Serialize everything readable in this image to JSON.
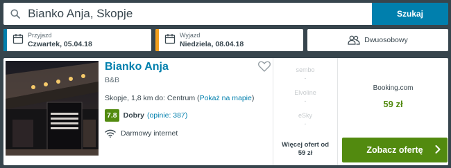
{
  "search": {
    "value": "Bianko Anja, Skopje",
    "button_label": "Szukaj"
  },
  "filters": {
    "checkin": {
      "label": "Przyjazd",
      "value": "Czwartek, 05.04.18",
      "color": "#007fad"
    },
    "checkout": {
      "label": "Wyjazd",
      "value": "Niedziela, 08.04.18",
      "color": "#f29f1d"
    },
    "room": {
      "label": "Dwuosobowy",
      "icon": "two-people-icon"
    }
  },
  "hotel": {
    "name": "Bianko Anja",
    "type": "B&B",
    "location_text": "Skopje, 1,8 km do: Centrum (",
    "map_link": "Pokaż na mapie",
    "location_close": ")",
    "rating_score": "7.8",
    "rating_label": "Dobry",
    "reviews_link": "(opinie: 387)",
    "amenity": "Darmowy internet",
    "rating_color": "#528a0f"
  },
  "offers": {
    "items": [
      {
        "name": "sembo",
        "price": "-"
      },
      {
        "name": "Elvoline",
        "price": "-"
      },
      {
        "name": "eSky",
        "price": "-"
      }
    ],
    "more_line1": "Więcej ofert od",
    "more_line2": "59 zł"
  },
  "deal": {
    "source": "Booking.com",
    "price": "59 zł",
    "button_label": "Zobacz ofertę",
    "button_color": "#528a0f"
  },
  "colors": {
    "background": "#37454d",
    "accent": "#007fad"
  }
}
